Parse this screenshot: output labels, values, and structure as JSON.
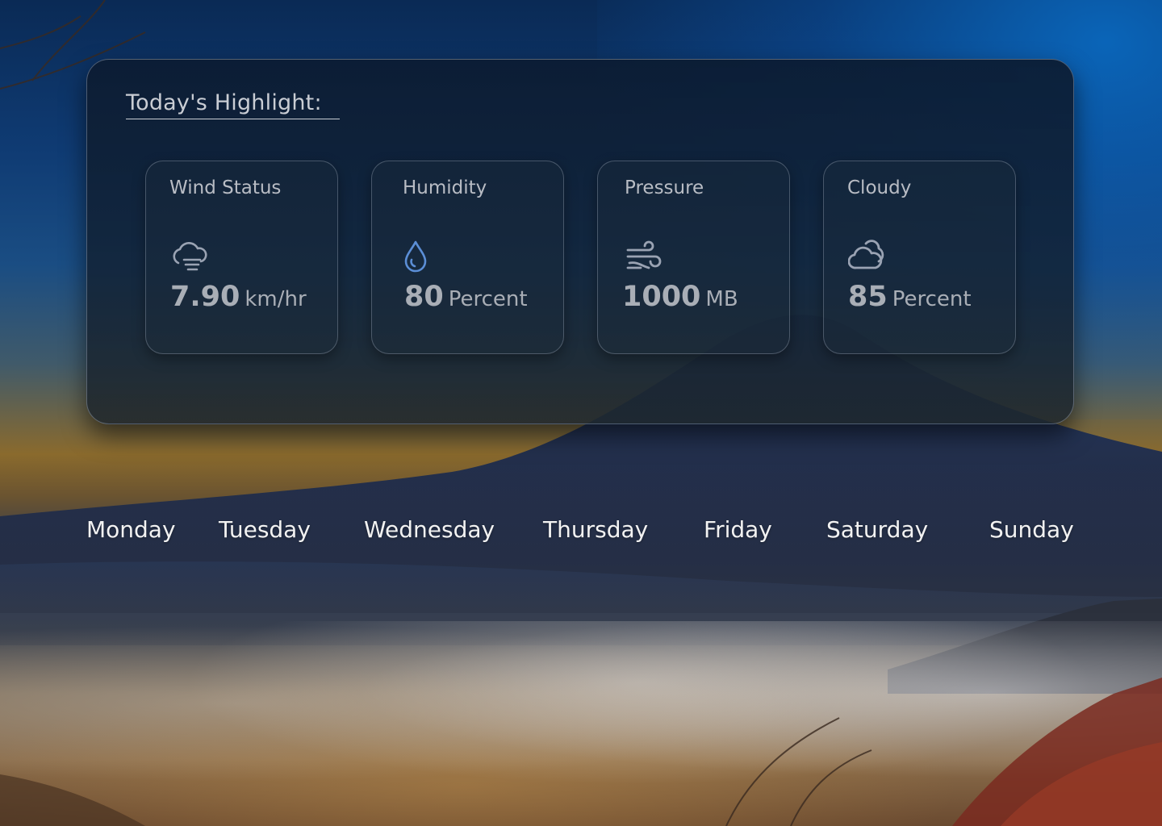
{
  "highlight": {
    "title": "Today's Highlight:",
    "cards": [
      {
        "label": "Wind Status",
        "value": "7.90",
        "unit": "km/hr",
        "icon": "cloud-wind-icon"
      },
      {
        "label": "Humidity",
        "value": "80",
        "unit": "Percent",
        "icon": "water-drop-icon"
      },
      {
        "label": "Pressure",
        "value": "1000",
        "unit": "MB",
        "icon": "wind-icon"
      },
      {
        "label": "Cloudy",
        "value": "85",
        "unit": "Percent",
        "icon": "cloud-sun-icon"
      }
    ]
  },
  "days": [
    "Monday",
    "Tuesday",
    "Wednesday",
    "Thursday",
    "Friday",
    "Saturday",
    "Sunday"
  ],
  "colors": {
    "icon_grey": "#9aa3b3",
    "icon_blue": "#5b8ed6",
    "text": "#f2f2f2"
  }
}
